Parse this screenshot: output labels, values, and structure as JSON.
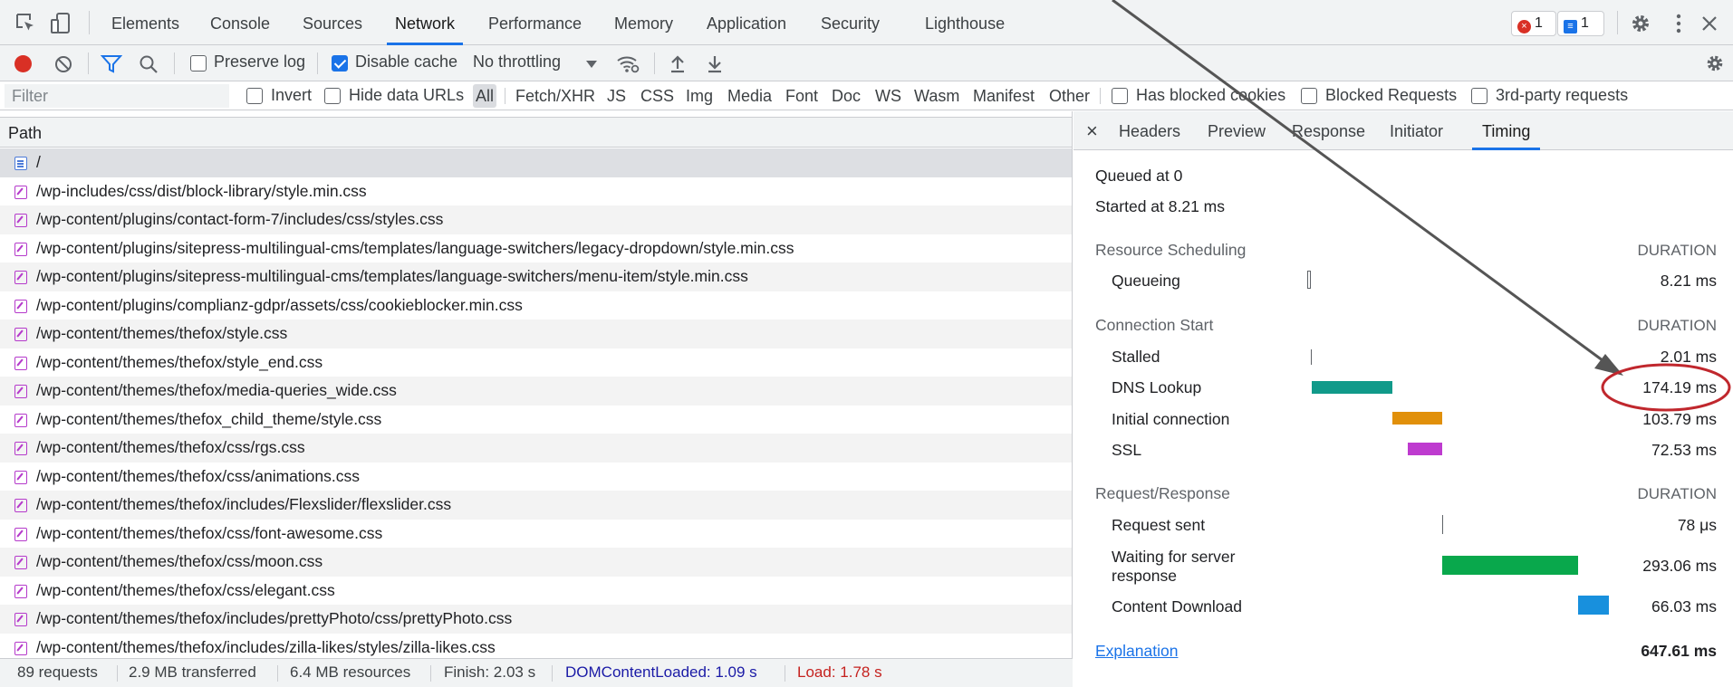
{
  "main_tabs": [
    "Elements",
    "Console",
    "Sources",
    "Network",
    "Performance",
    "Memory",
    "Application",
    "Security",
    "Lighthouse"
  ],
  "badges": {
    "errors": "1",
    "messages": "1"
  },
  "toolbar": {
    "preserve_log": "Preserve log",
    "preserve_log_checked": false,
    "disable_cache": "Disable cache",
    "disable_cache_checked": true,
    "throttling": "No throttling"
  },
  "filterbar": {
    "placeholder": "Filter",
    "invert": "Invert",
    "hide_data_urls": "Hide data URLs",
    "types": [
      "All",
      "Fetch/XHR",
      "JS",
      "CSS",
      "Img",
      "Media",
      "Font",
      "Doc",
      "WS",
      "Wasm",
      "Manifest",
      "Other"
    ],
    "has_blocked_cookies": "Has blocked cookies",
    "blocked_requests": "Blocked Requests",
    "third_party": "3rd-party requests"
  },
  "list": {
    "header": "Path",
    "rows": [
      "/",
      "/wp-includes/css/dist/block-library/style.min.css",
      "/wp-content/plugins/contact-form-7/includes/css/styles.css",
      "/wp-content/plugins/sitepress-multilingual-cms/templates/language-switchers/legacy-dropdown/style.min.css",
      "/wp-content/plugins/sitepress-multilingual-cms/templates/language-switchers/menu-item/style.min.css",
      "/wp-content/plugins/complianz-gdpr/assets/css/cookieblocker.min.css",
      "/wp-content/themes/thefox/style.css",
      "/wp-content/themes/thefox/style_end.css",
      "/wp-content/themes/thefox/media-queries_wide.css",
      "/wp-content/themes/thefox_child_theme/style.css",
      "/wp-content/themes/thefox/css/rgs.css",
      "/wp-content/themes/thefox/css/animations.css",
      "/wp-content/themes/thefox/includes/Flexslider/flexslider.css",
      "/wp-content/themes/thefox/css/font-awesome.css",
      "/wp-content/themes/thefox/css/moon.css",
      "/wp-content/themes/thefox/css/elegant.css",
      "/wp-content/themes/thefox/includes/prettyPhoto/css/prettyPhoto.css",
      "/wp-content/themes/thefox/includes/zilla-likes/styles/zilla-likes.css"
    ]
  },
  "statusbar": {
    "requests": "89 requests",
    "transferred": "2.9 MB transferred",
    "resources": "6.4 MB resources",
    "finish": "Finish: 2.03 s",
    "dom_content_loaded": "DOMContentLoaded: 1.09 s",
    "load": "Load: 1.78 s"
  },
  "panel": {
    "close": "×",
    "tabs": [
      "Headers",
      "Preview",
      "Response",
      "Initiator",
      "Timing"
    ],
    "queued_at": "Queued at 0",
    "started_at": "Started at 8.21 ms",
    "duration_label": "DURATION",
    "sections": [
      {
        "title": "Resource Scheduling",
        "rows": [
          {
            "label": "Queueing",
            "value": "8.21 ms"
          }
        ]
      },
      {
        "title": "Connection Start",
        "rows": [
          {
            "label": "Stalled",
            "value": "2.01 ms"
          },
          {
            "label": "DNS Lookup",
            "value": "174.19 ms"
          },
          {
            "label": "Initial connection",
            "value": "103.79 ms"
          },
          {
            "label": "SSL",
            "value": "72.53 ms"
          }
        ]
      },
      {
        "title": "Request/Response",
        "rows": [
          {
            "label": "Request sent",
            "value": "78 μs"
          },
          {
            "label": "Waiting for server",
            "label2": "response",
            "value": "293.06 ms"
          },
          {
            "label": "Content Download",
            "value": "66.03 ms"
          }
        ]
      }
    ],
    "explanation": "Explanation",
    "total": "647.61 ms"
  },
  "colors": {
    "accent": "#1a73e8",
    "record": "#d93025",
    "dns": "#119a8a",
    "initial_connection": "#e1900a",
    "ssl": "#be3bcf",
    "waiting": "#09a84c",
    "download": "#1890dd",
    "annotation": "#c0272d"
  }
}
